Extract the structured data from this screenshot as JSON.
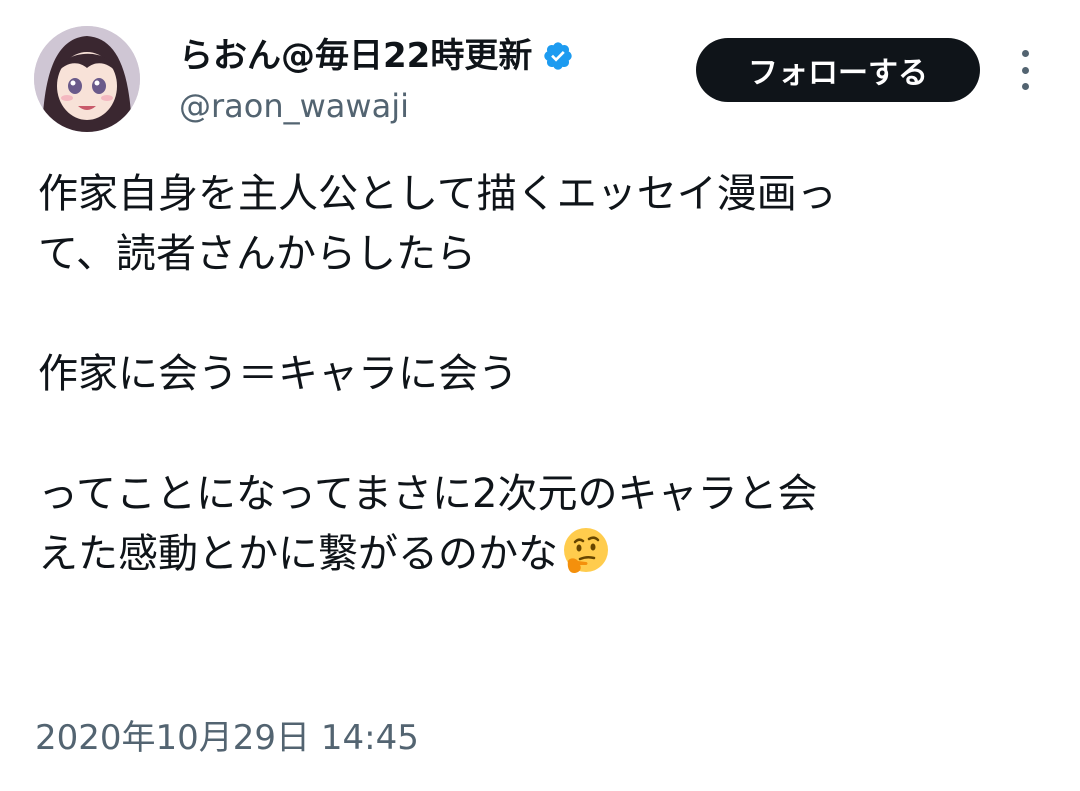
{
  "author": {
    "display_name": "らおん@毎日22時更新",
    "handle": "@raon_wawaji",
    "verified_icon": "verified-badge-icon",
    "avatar_icon": "anime-girl-avatar"
  },
  "actions": {
    "follow_label": "フォローする",
    "more_icon": "vertical-ellipsis-icon"
  },
  "tweet": {
    "lines": [
      "作家自身を主人公として描くエッセイ漫画っ",
      "て、読者さんからしたら",
      "作家に会う＝キャラに会う",
      "ってことになってまさに2次元のキャラと会",
      "えた感動とかに繋がるのかな"
    ],
    "emoji": "thinking-face-emoji",
    "timestamp": "2020年10月29日 14:45"
  },
  "colors": {
    "text": "#0f1419",
    "secondary": "#536471",
    "verified": "#1d9bf0",
    "follow_bg": "#0f1419"
  }
}
